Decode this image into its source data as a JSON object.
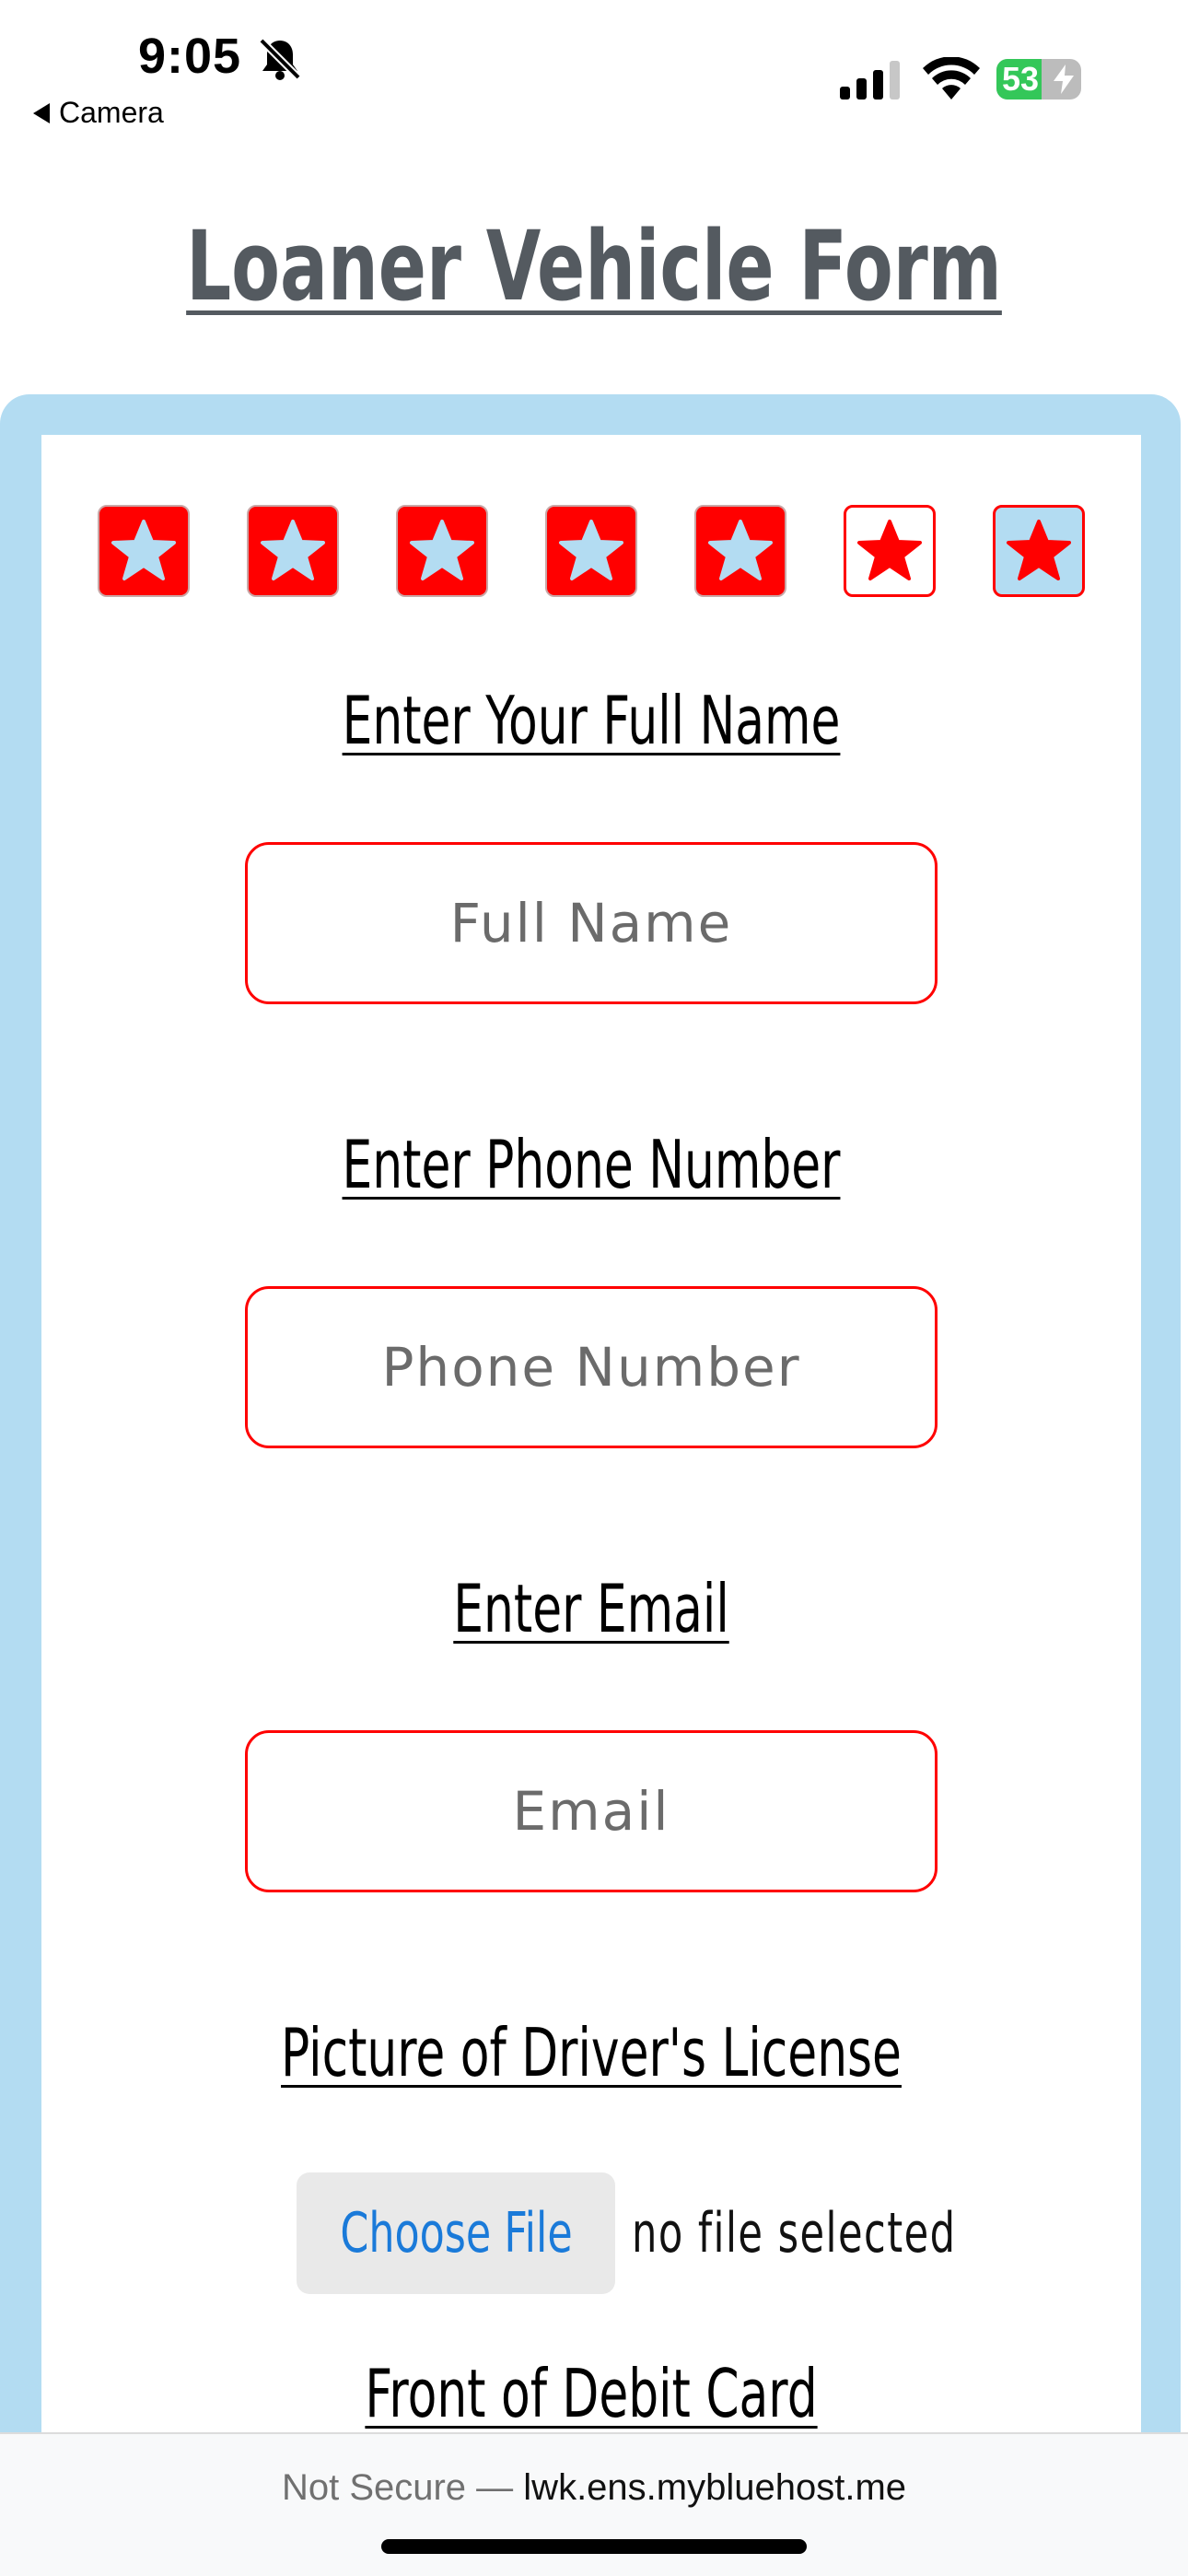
{
  "status_bar": {
    "time": "9:05",
    "back_app": "Camera",
    "battery_percent": "53",
    "battery_level": 0.53
  },
  "page": {
    "title": "Loaner Vehicle Form"
  },
  "steps": [
    {
      "state": "completed"
    },
    {
      "state": "completed"
    },
    {
      "state": "completed"
    },
    {
      "state": "completed"
    },
    {
      "state": "completed"
    },
    {
      "state": "current"
    },
    {
      "state": "upcoming"
    }
  ],
  "colors": {
    "accent": "#ff0000",
    "frame": "#b3dcf2",
    "title": "#545a60",
    "link": "#1a7ad9"
  },
  "form": {
    "full_name_label": "Enter Your Full Name",
    "full_name_placeholder": "Full Name",
    "full_name_value": "",
    "phone_label": "Enter Phone Number",
    "phone_placeholder": "Phone Number",
    "phone_value": "",
    "email_label": "Enter Email",
    "email_placeholder": "Email",
    "email_value": "",
    "license_label": "Picture of Driver's License",
    "choose_file_label": "Choose File",
    "file_status": "no file selected",
    "debit_card_label": "Front of Debit Card"
  },
  "browser": {
    "security_label": "Not Secure —",
    "domain": "lwk.ens.mybluehost.me"
  }
}
